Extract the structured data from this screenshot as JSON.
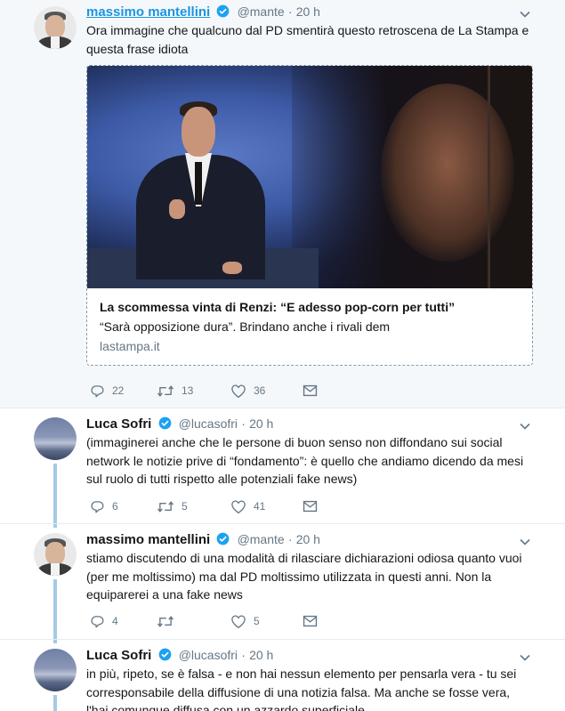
{
  "tweets": [
    {
      "name": "massimo mantellini",
      "handle": "@mante",
      "dot": "·",
      "time": "20 h",
      "text": "Ora immagine che qualcuno dal PD smentirà questo retroscena de La Stampa e questa frase idiota",
      "card": {
        "title": "La scommessa vinta di Renzi: “E adesso pop-corn per tutti”",
        "description": "“Sarà opposizione dura”. Brindano anche i rivali dem",
        "domain": "lastampa.it"
      },
      "replies": "22",
      "retweets": "13",
      "likes": "36"
    },
    {
      "name": "Luca Sofri",
      "handle": "@lucasofri",
      "dot": "·",
      "time": "20 h",
      "text": "(immaginerei anche che le persone di buon senso non diffondano sui social network le notizie prive di “fondamento”: è quello che andiamo dicendo da mesi sul ruolo di tutti rispetto alle potenziali fake news)",
      "replies": "6",
      "retweets": "5",
      "likes": "41"
    },
    {
      "name": "massimo mantellini",
      "handle": "@mante",
      "dot": "·",
      "time": "20 h",
      "text": "stiamo discutendo di una modalità di rilasciare dichiarazioni odiosa quanto vuoi (per me moltissimo) ma dal PD moltissimo utilizzata in questi anni. Non la equiparerei a una fake news",
      "replies": "4",
      "retweets": "",
      "likes": "5"
    },
    {
      "name": "Luca Sofri",
      "handle": "@lucasofri",
      "dot": "·",
      "time": "20 h",
      "text": "in più, ripeto, se è falsa - e non hai nessun elemento per pensarla vera - tu sei corresponsabile della diffusione di una notizia falsa. Ma anche se fosse vera, l'hai comunque diffusa con un azzardo superficiale."
    }
  ],
  "colors": {
    "accent": "#1b95e0",
    "thread_line": "#a3cbe6",
    "muted": "#657786",
    "focused_bg": "#f5f8fa"
  }
}
